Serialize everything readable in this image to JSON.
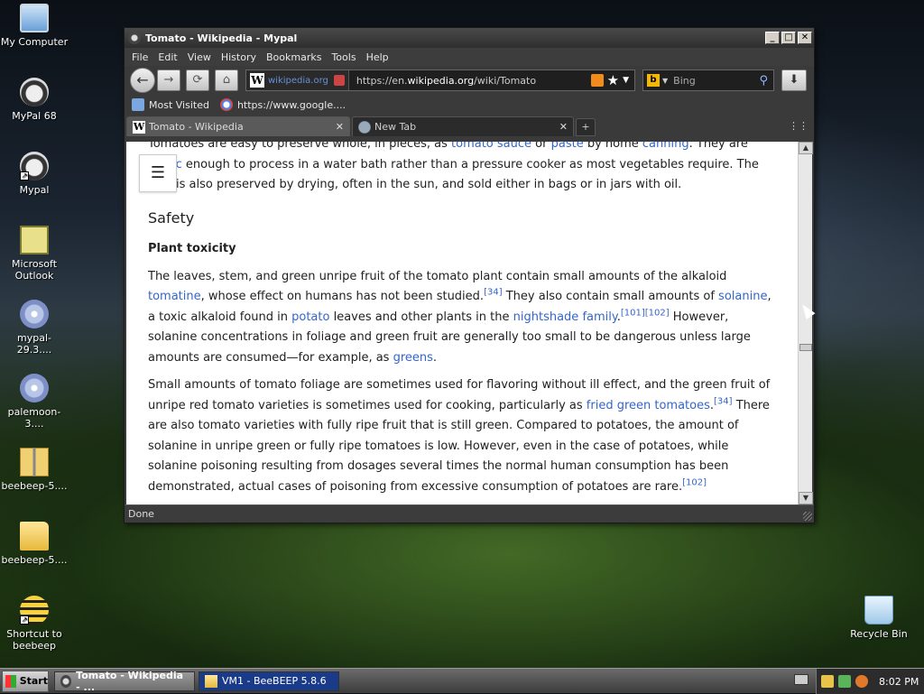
{
  "desktop": {
    "icons": [
      {
        "label": "My Computer"
      },
      {
        "label": "MyPal 68"
      },
      {
        "label": "Mypal"
      },
      {
        "label": "Microsoft Outlook"
      },
      {
        "label": "mypal-29.3...."
      },
      {
        "label": "palemoon-3...."
      },
      {
        "label": "beebeep-5...."
      },
      {
        "label": "beebeep-5...."
      },
      {
        "label": "Shortcut to beebeep"
      },
      {
        "label": "Recycle Bin"
      }
    ]
  },
  "window": {
    "title": "Tomato - Wikipedia - Mypal",
    "controls": {
      "minimize": "_",
      "maximize": "□",
      "close": "✕"
    },
    "menu": [
      "File",
      "Edit",
      "View",
      "History",
      "Bookmarks",
      "Tools",
      "Help"
    ],
    "nav": {
      "back": "←",
      "forward": "→",
      "reload": "⟳",
      "home": "⌂",
      "site_domain": "wikipedia.org",
      "url_prefix": "https://en.",
      "url_host": "wikipedia.org",
      "url_path": "/wiki/Tomato",
      "search_placeholder": "Bing",
      "download": "⬇"
    },
    "bookmarks": [
      {
        "label": "Most Visited"
      },
      {
        "label": "https://www.google...."
      }
    ],
    "tabs": [
      {
        "label": "Tomato - Wikipedia",
        "active": true
      },
      {
        "label": "New Tab",
        "active": false
      }
    ],
    "status": "Done"
  },
  "article": {
    "p0": {
      "t1": "Tomatoes are easy to preserve whole, in pieces, as ",
      "l1": "tomato sauce",
      "t2": " or ",
      "l2": "paste",
      "t3": " by home ",
      "l3": "canning",
      "t4": ". They are ",
      "l4": "acidic",
      "t5": " enough to process in a water bath rather than a pressure cooker as most vegetables require. The fruit is also preserved by drying, often in the sun, and sold either in bags or in jars with oil."
    },
    "h2": "Safety",
    "h3": "Plant toxicity",
    "p1": {
      "t1": "The leaves, stem, and green unripe fruit of the tomato plant contain small amounts of the alkaloid ",
      "l1": "tomatine",
      "t2": ", whose effect on humans has not been studied.",
      "r1": "[34]",
      "t3": " They also contain small amounts of ",
      "l2": "solanine",
      "t4": ", a toxic alkaloid found in ",
      "l3": "potato",
      "t5": " leaves and other plants in the ",
      "l4": "nightshade family",
      "t6": ".",
      "r2": "[101][102]",
      "t7": " However, solanine concentrations in foliage and green fruit are generally too small to be dangerous unless large amounts are consumed—for example, as ",
      "l5": "greens",
      "t8": "."
    },
    "p2": {
      "t1": "Small amounts of tomato foliage are sometimes used for flavoring without ill effect, and the green fruit of unripe red tomato varieties is sometimes used for cooking, particularly as ",
      "l1": "fried green tomatoes",
      "t2": ".",
      "r1": "[34]",
      "t3": " There are also tomato varieties with fully ripe fruit that is still green. Compared to potatoes, the amount of solanine in unripe green or fully ripe tomatoes is low. However, even in the case of potatoes, while solanine poisoning resulting from dosages several times the normal human consumption has been demonstrated, actual cases of poisoning from excessive consumption of potatoes are rare.",
      "r2": "[102]"
    }
  },
  "taskbar": {
    "start": "Start",
    "tasks": [
      {
        "label": "Tomato - Wikipedia - ..."
      },
      {
        "label": "VM1 - BeeBEEP 5.8.6"
      }
    ],
    "clock": "8:02 PM"
  },
  "icons": {
    "toc": "☰",
    "rss": "rss-icon",
    "star": "★",
    "search": "🔍",
    "close_tab": "✕",
    "new_tab": "+",
    "list_tabs": "⋮⋮"
  }
}
